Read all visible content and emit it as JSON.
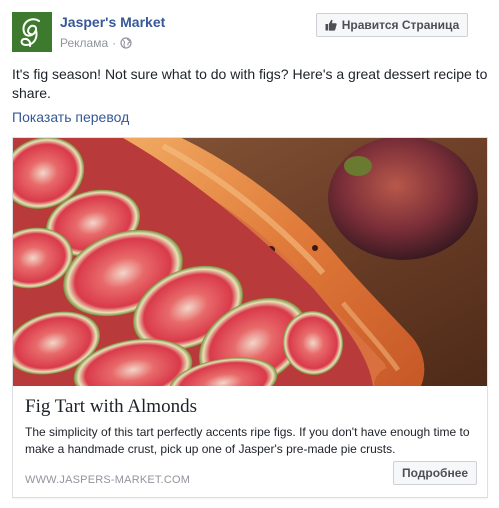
{
  "post": {
    "page_name": "Jasper's Market",
    "sponsored_label": "Реклама",
    "separator": "·",
    "text": "It's fig season! Not sure what to do with figs? Here's a great dessert recipe to share.",
    "translate_link": "Показать перевод",
    "like_page_button": "Нравится Страница"
  },
  "card": {
    "title": "Fig Tart with Almonds",
    "description": "The simplicity of this tart perfectly accents ripe figs. If you don't have enough time to make a handmade crust, pick up one of Jasper's pre-made pie crusts.",
    "domain": "WWW.JASPERS-MARKET.COM",
    "cta_button": "Подробнее"
  },
  "icons": {
    "avatar": "jaspers-market-logo",
    "privacy": "globe-icon",
    "like": "thumbs-up-icon"
  },
  "colors": {
    "link_blue": "#365899",
    "text": "#1d2129",
    "secondary_text": "#90949c",
    "button_bg": "#f6f7f9",
    "border": "#dddfe2",
    "avatar_green": "#3d7a2e"
  }
}
